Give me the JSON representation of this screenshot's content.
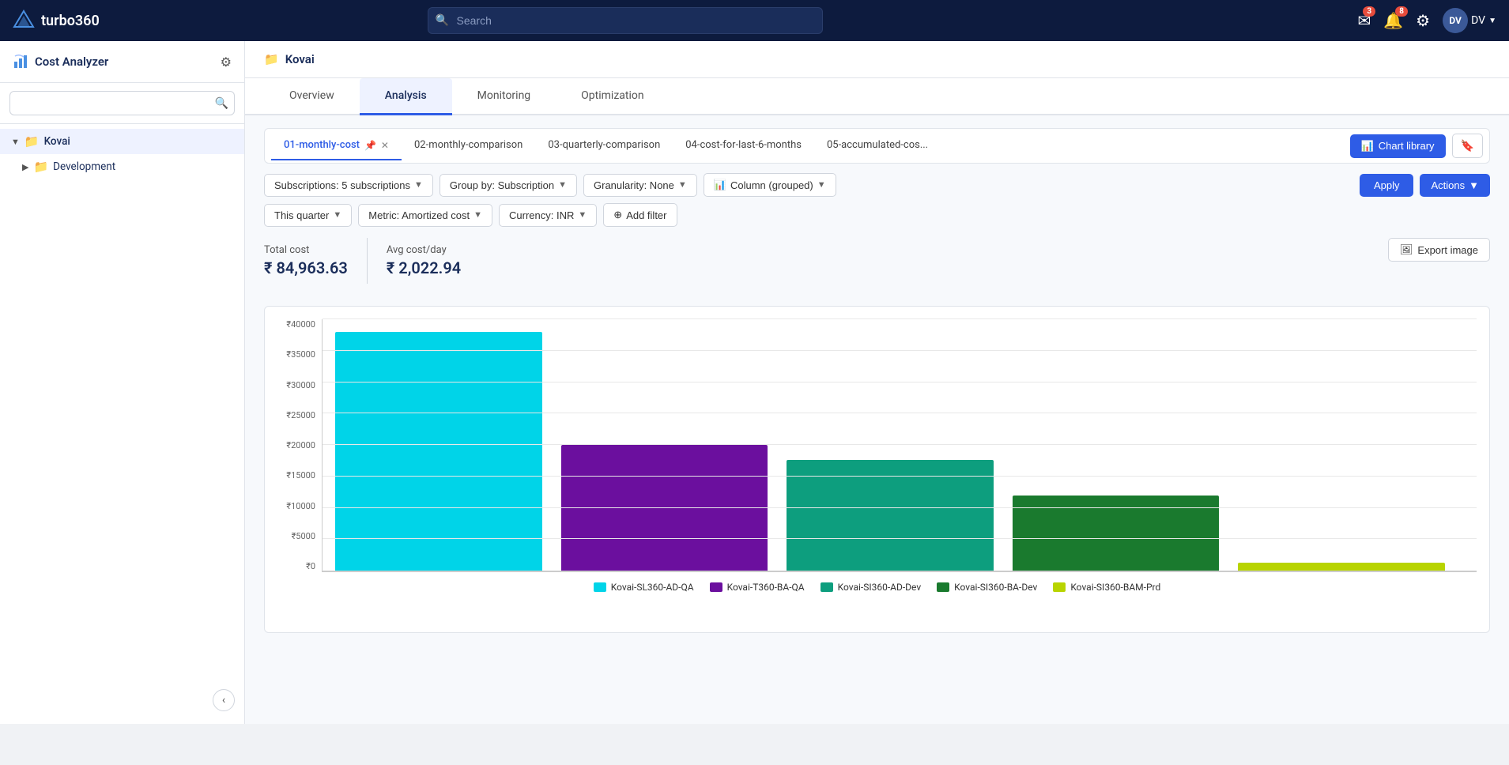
{
  "app": {
    "logo_text": "turbo360",
    "nav_badge_messages": "3",
    "nav_badge_notifications": "8",
    "user_initials": "DV",
    "user_label": "DV"
  },
  "search": {
    "placeholder": "Search"
  },
  "sidebar": {
    "title": "Cost Analyzer",
    "search_placeholder": "",
    "tree": [
      {
        "label": "Kovai",
        "expanded": true,
        "active": true
      },
      {
        "label": "Development",
        "active": false
      }
    ]
  },
  "breadcrumb": {
    "folder": "Kovai"
  },
  "main_tabs": [
    {
      "label": "Overview",
      "active": false
    },
    {
      "label": "Analysis",
      "active": true
    },
    {
      "label": "Monitoring",
      "active": false
    },
    {
      "label": "Optimization",
      "active": false
    }
  ],
  "chart_tabs": [
    {
      "label": "01-monthly-cost",
      "active": true,
      "pinned": true,
      "closable": true
    },
    {
      "label": "02-monthly-comparison",
      "active": false
    },
    {
      "label": "03-quarterly-comparison",
      "active": false
    },
    {
      "label": "04-cost-for-last-6-months",
      "active": false
    },
    {
      "label": "05-accumulated-cos...",
      "active": false
    }
  ],
  "buttons": {
    "chart_library": "Chart library",
    "apply": "Apply",
    "actions": "Actions",
    "export_image": "Export image"
  },
  "filters": {
    "subscriptions": "Subscriptions: 5 subscriptions",
    "group_by": "Group by: Subscription",
    "granularity": "Granularity: None",
    "chart_type": "Column (grouped)",
    "date_range": "This quarter",
    "metric": "Metric: Amortized cost",
    "currency": "Currency: INR",
    "add_filter": "Add filter"
  },
  "stats": {
    "total_cost_label": "Total cost",
    "total_cost_value": "₹ 84,963.63",
    "avg_cost_label": "Avg cost/day",
    "avg_cost_value": "₹ 2,022.94"
  },
  "chart": {
    "y_labels": [
      "₹0",
      "₹5000",
      "₹10000",
      "₹15000",
      "₹20000",
      "₹25000",
      "₹30000",
      "₹35000",
      "₹40000"
    ],
    "bars": [
      {
        "label": "Kovai-SL360-AD-QA",
        "color": "#00d4e8",
        "height_pct": 95
      },
      {
        "label": "Kovai-T360-BA-QA",
        "color": "#6b0f9e",
        "height_pct": 50
      },
      {
        "label": "Kovai-SI360-AD-Dev",
        "color": "#0d9e7e",
        "height_pct": 44
      },
      {
        "label": "Kovai-SI360-BA-Dev",
        "color": "#1a7a2e",
        "height_pct": 30
      },
      {
        "label": "Kovai-SI360-BAM-Prd",
        "color": "#b8d400",
        "height_pct": 3
      }
    ]
  }
}
